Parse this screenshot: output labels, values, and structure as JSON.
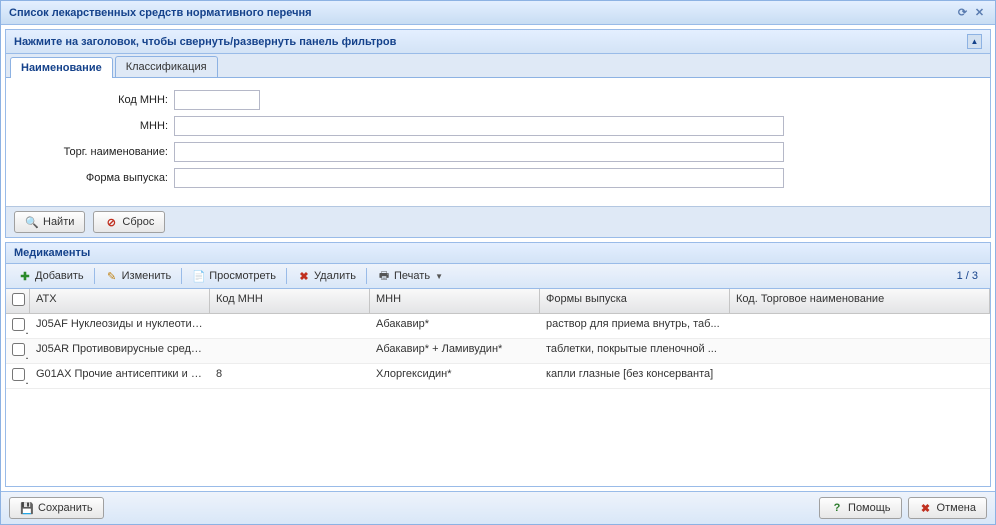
{
  "window": {
    "title": "Список лекарственных средств нормативного перечня"
  },
  "filter": {
    "header": "Нажмите на заголовок, чтобы свернуть/развернуть панель фильтров",
    "tabs": [
      "Наименование",
      "Классификация"
    ],
    "fields": {
      "code_mnn_label": "Код МНН:",
      "mnn_label": "МНН:",
      "trade_label": "Торг. наименование:",
      "form_label": "Форма выпуска:",
      "code_mnn_value": "",
      "mnn_value": "",
      "trade_value": "",
      "form_value": ""
    },
    "buttons": {
      "find": "Найти",
      "reset": "Сброс"
    }
  },
  "grid": {
    "title": "Медикаменты",
    "toolbar": {
      "add": "Добавить",
      "edit": "Изменить",
      "view": "Просмотреть",
      "delete": "Удалить",
      "print": "Печать",
      "page_info": "1 / 3"
    },
    "columns": {
      "atc": "АТХ",
      "code": "Код МНН",
      "mnn": "МНН",
      "form": "Формы выпуска",
      "trade": "Код. Торговое наименование"
    },
    "rows": [
      {
        "atc": "J05AF Нуклеозиды и нуклеотид...",
        "code": "",
        "mnn": "Абакавир*",
        "form": "раствор для приема внутрь, таб...",
        "trade": ""
      },
      {
        "atc": "J05AR Противовирусные средст...",
        "code": "",
        "mnn": "Абакавир* + Ламивудин*",
        "form": "таблетки, покрытые пленочной ...",
        "trade": ""
      },
      {
        "atc": "G01AX Прочие антисептики и п...",
        "code": "8",
        "mnn": "Хлоргексидин*",
        "form": "капли глазные [без консерванта]",
        "trade": ""
      }
    ]
  },
  "footer": {
    "save": "Сохранить",
    "help": "Помощь",
    "cancel": "Отмена"
  }
}
